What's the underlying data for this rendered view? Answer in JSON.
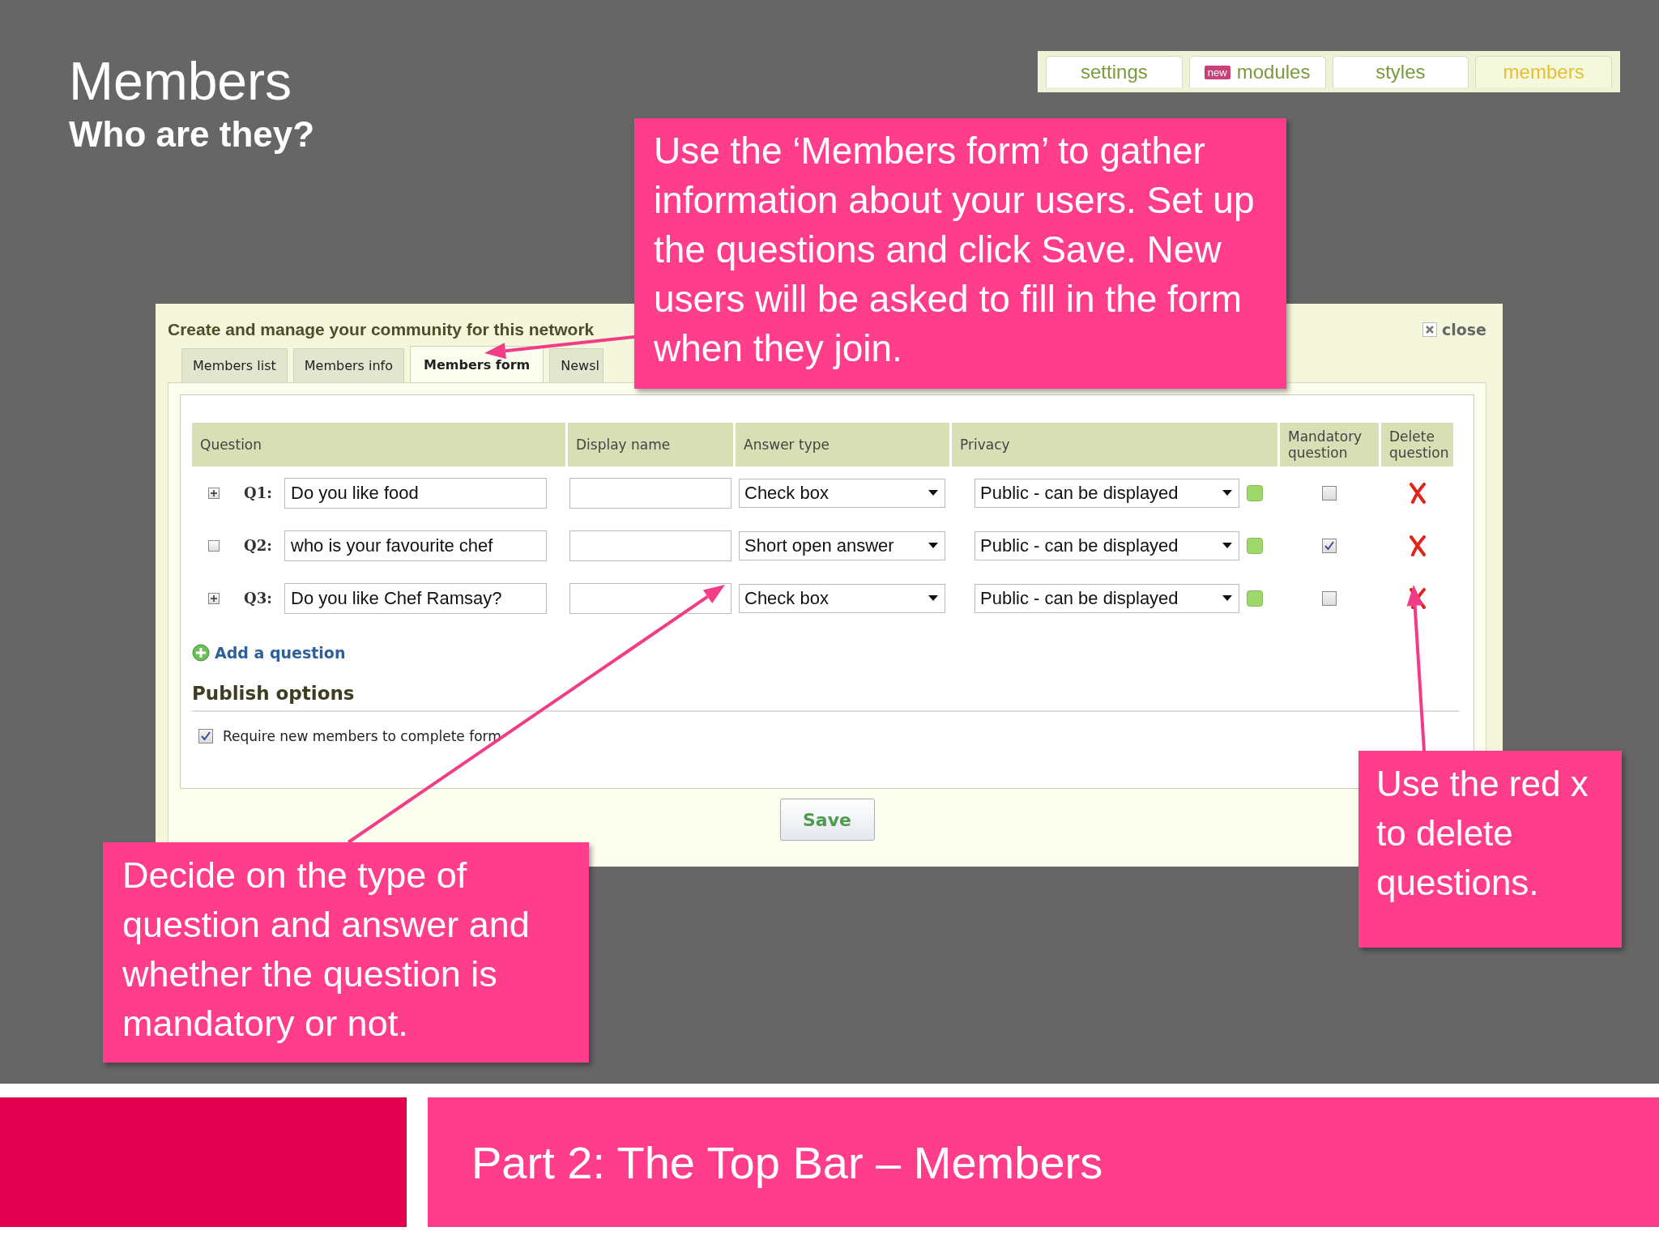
{
  "slide": {
    "title": "Members",
    "subtitle": "Who are they?"
  },
  "top_tabs": [
    {
      "label": "settings",
      "selected": false
    },
    {
      "label": "modules",
      "badge": "new",
      "selected": false
    },
    {
      "label": "styles",
      "selected": false
    },
    {
      "label": "members",
      "selected": true
    }
  ],
  "dialog": {
    "title": "Create and manage your community for this network",
    "close": "close",
    "tabs": [
      {
        "label": "Members list",
        "selected": false
      },
      {
        "label": "Members info",
        "selected": false
      },
      {
        "label": "Members form",
        "selected": true
      },
      {
        "label": "Newsl",
        "selected": false
      }
    ],
    "columns": [
      "Question",
      "Display name",
      "Answer type",
      "Privacy",
      "Mandatory question",
      "Delete question"
    ],
    "questions": [
      {
        "expandable": true,
        "number": "Q1:",
        "text": "Do you like food",
        "answer_type": "Check box",
        "privacy": "Public - can be displayed",
        "mandatory": false
      },
      {
        "expandable": false,
        "number": "Q2:",
        "text": "who is your favourite chef",
        "answer_type": "Short open answer",
        "privacy": "Public - can be displayed",
        "mandatory": true
      },
      {
        "expandable": true,
        "number": "Q3:",
        "text": "Do you like Chef Ramsay?",
        "answer_type": "Check box",
        "privacy": "Public - can be displayed",
        "mandatory": false
      }
    ],
    "add_question": "Add a question",
    "publish": {
      "heading": "Publish options",
      "option": "Require new members to complete form",
      "checked": true
    },
    "save": "Save"
  },
  "callouts": [
    {
      "text": "Use the ‘Members form’ to gather information about your users. Set up the questions and click Save. New users will be asked to fill in the form when they join."
    },
    {
      "text": "Decide on the type of question and answer and whether the question is mandatory or not."
    },
    {
      "text": "Use the red x to delete questions."
    }
  ],
  "footer": {
    "title": "Part 2: The Top Bar – Members"
  }
}
